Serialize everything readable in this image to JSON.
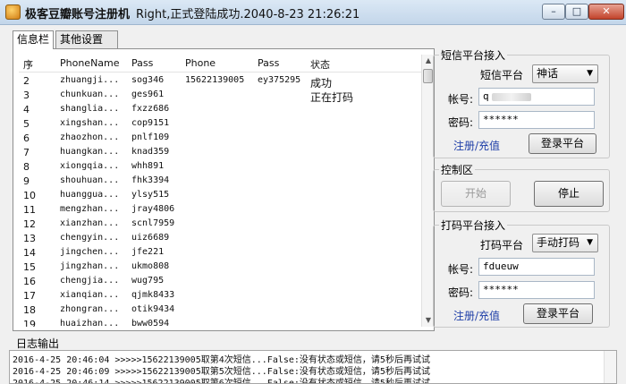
{
  "window": {
    "title": "极客豆瓣账号注册机",
    "status_text": "Right,正式登陆成功.2040-8-23 21:26:21",
    "min_glyph": "–",
    "max_glyph": "□",
    "close_glyph": "✕"
  },
  "tabs": [
    {
      "label": "信息栏",
      "active": true
    },
    {
      "label": "其他设置",
      "active": false
    }
  ],
  "table": {
    "headers": [
      "序",
      "PhoneName",
      "Pass",
      "Phone",
      "Pass",
      "状态"
    ],
    "rows": [
      {
        "num": "2",
        "name": "zhuangji...",
        "pass": "sog346",
        "phone": "15622139005",
        "pass2": "ey375295",
        "state": "成功"
      },
      {
        "num": "3",
        "name": "chunkuan...",
        "pass": "ges961",
        "phone": "",
        "pass2": "",
        "state": "正在打码"
      },
      {
        "num": "4",
        "name": "shanglia...",
        "pass": "fxzz686",
        "phone": "",
        "pass2": "",
        "state": ""
      },
      {
        "num": "5",
        "name": "xingshan...",
        "pass": "cop9151",
        "phone": "",
        "pass2": "",
        "state": ""
      },
      {
        "num": "6",
        "name": "zhaozhon...",
        "pass": "pnlf109",
        "phone": "",
        "pass2": "",
        "state": ""
      },
      {
        "num": "7",
        "name": "huangkan...",
        "pass": "knad359",
        "phone": "",
        "pass2": "",
        "state": ""
      },
      {
        "num": "8",
        "name": "xiongqia...",
        "pass": "whh891",
        "phone": "",
        "pass2": "",
        "state": ""
      },
      {
        "num": "9",
        "name": "shouhuan...",
        "pass": "fhk3394",
        "phone": "",
        "pass2": "",
        "state": ""
      },
      {
        "num": "10",
        "name": "huanggua...",
        "pass": "ylsy515",
        "phone": "",
        "pass2": "",
        "state": ""
      },
      {
        "num": "11",
        "name": "mengzhan...",
        "pass": "jray4806",
        "phone": "",
        "pass2": "",
        "state": ""
      },
      {
        "num": "12",
        "name": "xianzhan...",
        "pass": "scnl7959",
        "phone": "",
        "pass2": "",
        "state": ""
      },
      {
        "num": "13",
        "name": "chengyin...",
        "pass": "uiz6689",
        "phone": "",
        "pass2": "",
        "state": ""
      },
      {
        "num": "14",
        "name": "jingchen...",
        "pass": "jfe221",
        "phone": "",
        "pass2": "",
        "state": ""
      },
      {
        "num": "15",
        "name": "jingzhan...",
        "pass": "ukmo808",
        "phone": "",
        "pass2": "",
        "state": ""
      },
      {
        "num": "16",
        "name": "chengjia...",
        "pass": "wug795",
        "phone": "",
        "pass2": "",
        "state": ""
      },
      {
        "num": "17",
        "name": "xianqian...",
        "pass": "qjmk8433",
        "phone": "",
        "pass2": "",
        "state": ""
      },
      {
        "num": "18",
        "name": "zhongran...",
        "pass": "otik9434",
        "phone": "",
        "pass2": "",
        "state": ""
      },
      {
        "num": "19",
        "name": "huaizhan...",
        "pass": "bww0594",
        "phone": "",
        "pass2": "",
        "state": ""
      }
    ]
  },
  "sms_panel": {
    "title": "短信平台接入",
    "platform_label": "短信平台",
    "platform_value": "神话",
    "account_label": "帐号:",
    "account_value": "q",
    "password_label": "密码:",
    "password_value": "******",
    "register_link": "注册/充值",
    "login_button": "登录平台"
  },
  "control_panel": {
    "title": "控制区",
    "start_button": "开始",
    "stop_button": "停止"
  },
  "captcha_panel": {
    "title": "打码平台接入",
    "platform_label": "打码平台",
    "platform_value": "手动打码",
    "account_label": "帐号:",
    "account_value": "fdueuw",
    "password_label": "密码:",
    "password_value": "******",
    "register_link": "注册/充值",
    "login_button": "登录平台"
  },
  "log": {
    "label": "日志输出",
    "lines": [
      "2016-4-25 20:46:04 >>>>>15622139005取第4次短信...False:没有状态或短信，请5秒后再试试",
      "2016-4-25 20:46:09 >>>>>15622139005取第5次短信...False:没有状态或短信，请5秒后再试试",
      "2016-4-25 20:46:14 >>>>>15622139005取第6次短信...False:没有状态或短信，请5秒后再试试"
    ]
  },
  "colors": {
    "link": "#1f3fa8",
    "titlebar": "#c3d6ea",
    "close_button": "#c2432b"
  }
}
